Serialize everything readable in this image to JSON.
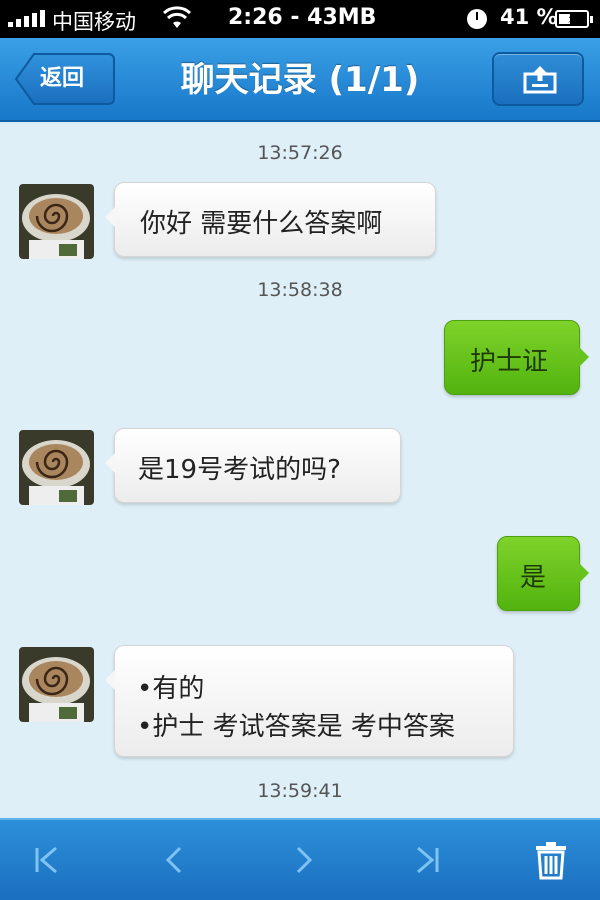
{
  "status_bar": {
    "carrier": "中国移动",
    "time": "2:26 - 43MB",
    "battery": "41 %",
    "battery_level": 0.41
  },
  "nav": {
    "title": "聊天记录 (1/1)",
    "back_label": "返回",
    "share_icon": "share-export-icon"
  },
  "messages": [
    {
      "timestamp": "13:57:26"
    },
    {
      "side": "in",
      "lines": [
        "你好 需要什么答案啊"
      ]
    },
    {
      "timestamp": "13:58:38"
    },
    {
      "side": "out",
      "lines": [
        "护士证"
      ]
    },
    {
      "side": "in",
      "lines": [
        "是19号考试的吗?"
      ]
    },
    {
      "side": "out",
      "lines": [
        "是"
      ]
    },
    {
      "side": "in",
      "lines": [
        "•有的",
        "•护士 考试答案是 考中答案"
      ]
    },
    {
      "timestamp": "13:59:41"
    }
  ],
  "toolbar": {
    "icons": [
      "first-page-icon",
      "previous-page-icon",
      "next-page-icon",
      "last-page-icon",
      "trash-icon"
    ]
  },
  "colors": {
    "nav_blue": "#1877c9",
    "incoming_bubble": "#f2f2f2",
    "outgoing_bubble": "#66c21c",
    "chat_background": "#dfeff7"
  }
}
